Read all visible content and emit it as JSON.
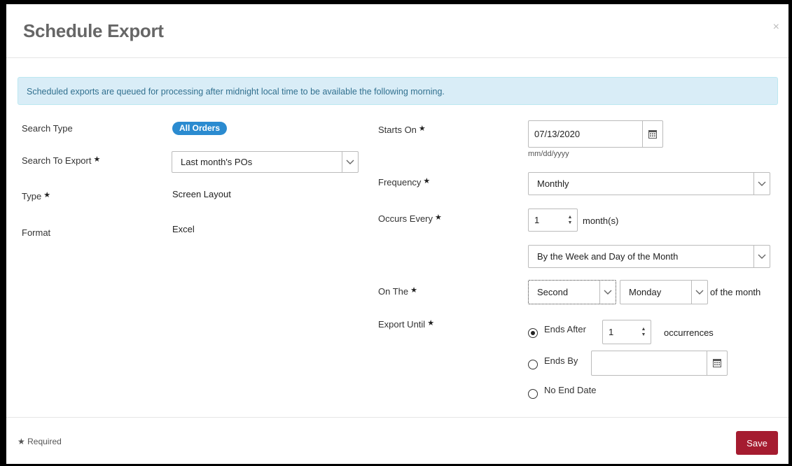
{
  "dialog": {
    "title": "Schedule Export",
    "close_label": "×",
    "info_message": "Scheduled exports are queued for processing after midnight local time to be available the following morning."
  },
  "left": {
    "search_type_label": "Search Type",
    "search_type_value": "All Orders",
    "search_to_export_label": "Search To Export",
    "search_to_export_value": "Last month's POs",
    "type_label": "Type",
    "type_value": "Screen Layout",
    "format_label": "Format",
    "format_value": "Excel"
  },
  "right": {
    "starts_on_label": "Starts On",
    "starts_on_value": "07/13/2020",
    "date_hint": "mm/dd/yyyy",
    "frequency_label": "Frequency",
    "frequency_value": "Monthly",
    "occurs_every_label": "Occurs Every",
    "occurs_every_value": "1",
    "occurs_every_unit": "month(s)",
    "monthly_mode_value": "By the Week and Day of the Month",
    "on_the_label": "On The",
    "week_value": "Second",
    "day_value": "Monday",
    "of_month_text": "of the month",
    "export_until_label": "Export Until",
    "ends_after_label": "Ends After",
    "ends_after_value": "1",
    "occurrences_text": "occurrences",
    "ends_by_label": "Ends By",
    "ends_by_value": "",
    "no_end_date_label": "No End Date",
    "selected_end_option": "Ends After"
  },
  "footer": {
    "required_star": "★",
    "required_text": "Required",
    "save_label": "Save"
  },
  "colors": {
    "badge": "#2b8bd0",
    "save": "#a51c30",
    "info_bg": "#d9edf7",
    "info_text": "#31708f"
  }
}
